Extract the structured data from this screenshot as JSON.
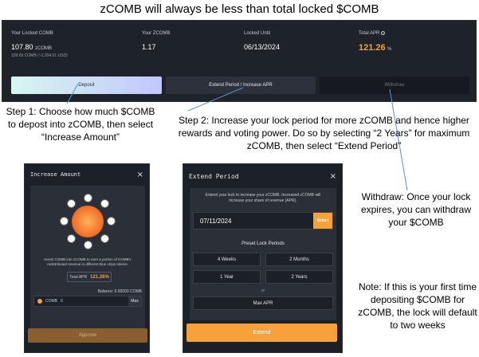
{
  "title": "zCOMB will always be less than total locked $COMB",
  "dashboard": {
    "locked_comb_label": "Your Locked COMB",
    "locked_comb_value": "107.80",
    "locked_comb_unit": "zCOMB",
    "locked_comb_sub": "109.69 COMB (~1,204.01 USD)",
    "zcomb_label": "Your ZCOMB",
    "zcomb_value": "1.17",
    "locked_until_label": "Locked Until",
    "locked_until_value": "06/13/2024",
    "apr_label": "Total APR",
    "apr_value": "121.26",
    "apr_unit": "%",
    "tabs": {
      "deposit": "Deposit",
      "extend": "Extend Period / Increase APR",
      "withdraw": "Withdraw"
    }
  },
  "annotations": {
    "step1": "Step 1: Choose how much $COMB to depost into zCOMB, then select “Increase Amount”",
    "step2": "Step 2: Increase your lock period for more zCOMB and hence higher rewards and voting power. Do so by selecting “2 Years” for maximum zCOMB, then select “Extend Period”",
    "withdraw": "Withdraw: Once your lock expires, you can withdraw your $COMB",
    "note": "Note: If this is your first time depositing $COMB for zCOMB, the lock will default to two weeks"
  },
  "increase_modal": {
    "title": "Increase Amount",
    "close": "×",
    "description": "Invest COMB into zCOMB to earn a portion of COMB's redistributed revenue in different blue chips tokens.",
    "apr_label": "Total APR",
    "apr_value": "121.26%",
    "balance": "Balance: 0.00000 COMB",
    "token_label": "COMB",
    "amount_value": "0",
    "max_label": "Max",
    "approve_label": "Approve"
  },
  "extend_modal": {
    "title": "Extend Period",
    "close": "×",
    "description": "Extend your lock to increase your zCOMB. Increased zCOMB will increase your share of revenue (APR).",
    "date_value": "07/11/2024",
    "select_label": "Select",
    "preset_title": "Preset Lock Periods",
    "presets": [
      "4 Weeks",
      "2 Months",
      "1 Year",
      "2 Years"
    ],
    "or_label": "or",
    "max_apr_label": "Max APR",
    "extend_label": "Extend"
  },
  "colors": {
    "accent": "#f7a13a",
    "panel": "#1e2229",
    "modal": "#1c2027"
  },
  "icons": [
    "close-icon",
    "info-icon",
    "comb-token-icon",
    "token-coin-icon"
  ]
}
